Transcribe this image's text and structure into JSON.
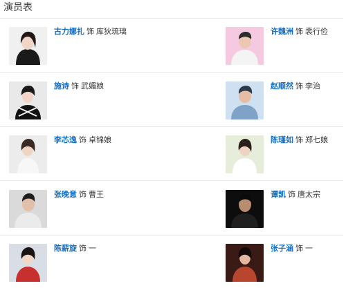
{
  "section": {
    "title": "演员表"
  },
  "as_word": "饰",
  "cast": [
    {
      "actor": "古力娜扎",
      "role": "库狄琉璃",
      "photo_icon": "actor-photo-1",
      "bg": "#f0f0f0",
      "accent": "#1a1a1a"
    },
    {
      "actor": "许魏洲",
      "role": "裴行俭",
      "photo_icon": "actor-photo-2",
      "bg": "#f5c9e0",
      "accent": "#2b2b2b"
    },
    {
      "actor": "施诗",
      "role": "武媚娘",
      "photo_icon": "actor-photo-3",
      "bg": "#e9e9e9",
      "accent": "#111111"
    },
    {
      "actor": "赵顺然",
      "role": "李治",
      "photo_icon": "actor-photo-4",
      "bg": "#cfe1f0",
      "accent": "#2c3a4a"
    },
    {
      "actor": "李芯逸",
      "role": "卓锦娘",
      "photo_icon": "actor-photo-5",
      "bg": "#ececec",
      "accent": "#f7f7f7"
    },
    {
      "actor": "陈瑾如",
      "role": "郑七娘",
      "photo_icon": "actor-photo-6",
      "bg": "#e6eddb",
      "accent": "#ffffff"
    },
    {
      "actor": "张晚意",
      "role": "曹王",
      "photo_icon": "actor-photo-7",
      "bg": "#dadada",
      "accent": "#ebebeb"
    },
    {
      "actor": "谭凯",
      "role": "唐太宗",
      "photo_icon": "actor-photo-8",
      "bg": "#0d0d0d",
      "accent": "#1f1f1f"
    },
    {
      "actor": "陈薪旋",
      "role": "一",
      "photo_icon": "actor-photo-9",
      "bg": "#d9dde6",
      "accent": "#c7302e"
    },
    {
      "actor": "张子涵",
      "role": "一",
      "photo_icon": "actor-photo-10",
      "bg": "#3a1a14",
      "accent": "#b8452d"
    }
  ]
}
